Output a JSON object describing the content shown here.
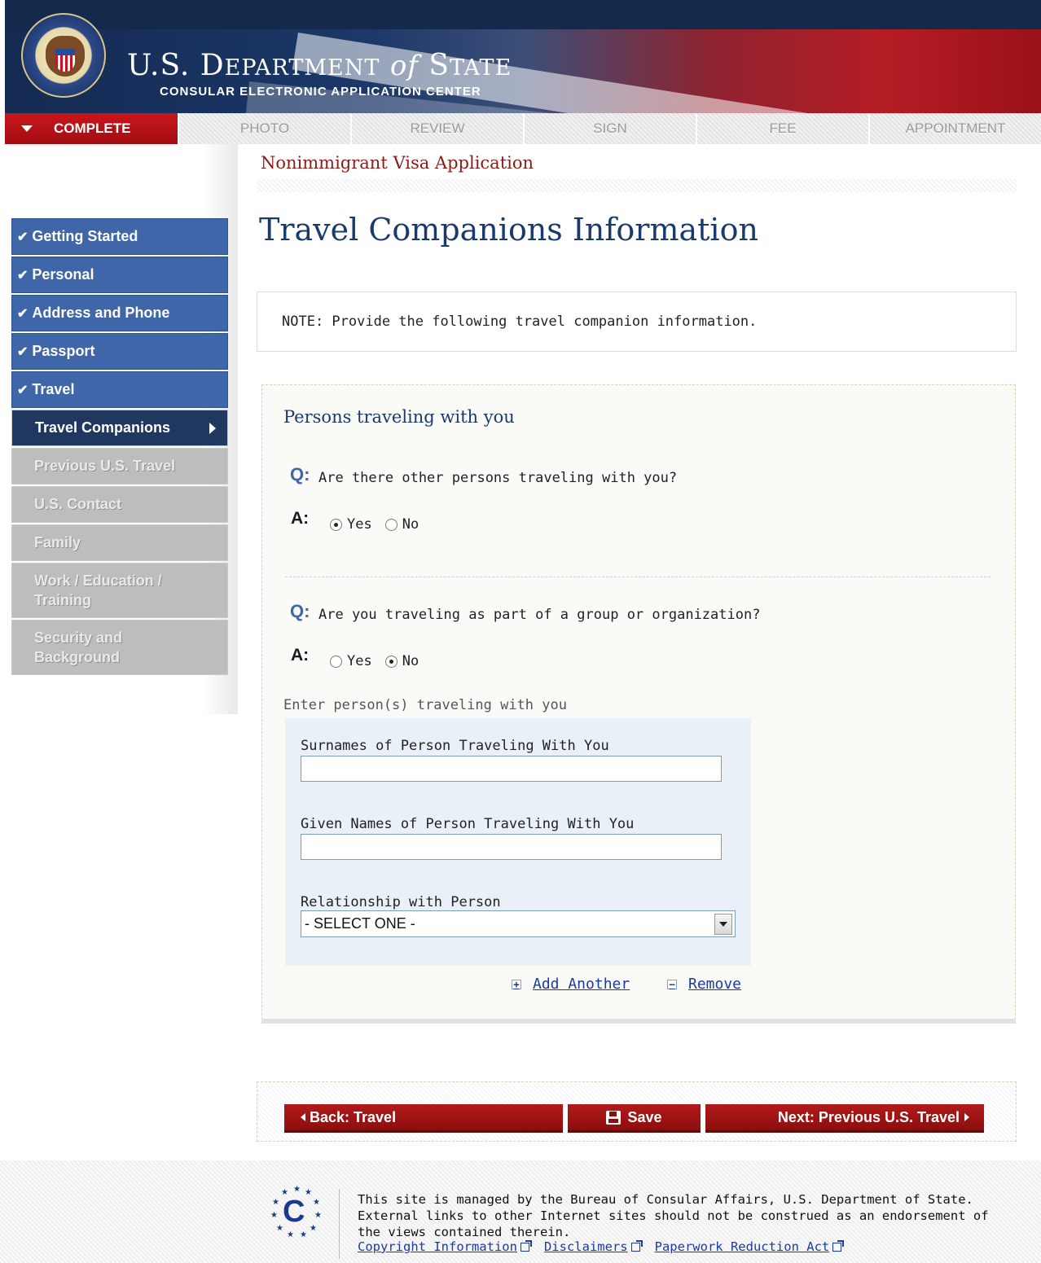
{
  "header": {
    "dept_main": "U.S. D",
    "dept_caps": "EPARTMENT",
    "dept_of": "of",
    "dept_state_s": "S",
    "dept_state_rest": "TATE",
    "subtitle": "CONSULAR ELECTRONIC APPLICATION CENTER"
  },
  "tabs": [
    {
      "label": "COMPLETE",
      "active": true
    },
    {
      "label": "PHOTO"
    },
    {
      "label": "REVIEW"
    },
    {
      "label": "SIGN"
    },
    {
      "label": "FEE"
    },
    {
      "label": "APPOINTMENT"
    }
  ],
  "sidebar": {
    "items": [
      {
        "label": "Getting Started",
        "state": "done"
      },
      {
        "label": "Personal",
        "state": "done"
      },
      {
        "label": "Address and Phone",
        "state": "done"
      },
      {
        "label": "Passport",
        "state": "done"
      },
      {
        "label": "Travel",
        "state": "done"
      },
      {
        "label": "Travel Companions",
        "state": "current"
      },
      {
        "label": "Previous U.S. Travel",
        "state": "todo"
      },
      {
        "label": "U.S. Contact",
        "state": "todo"
      },
      {
        "label": "Family",
        "state": "todo"
      },
      {
        "label": "Work / Education / Training",
        "state": "todo"
      },
      {
        "label": "Security and Background",
        "state": "todo"
      }
    ]
  },
  "main": {
    "app_title": "Nonimmigrant Visa Application",
    "page_heading": "Travel Companions Information",
    "note": "NOTE: Provide the following travel companion information.",
    "section_title": "Persons traveling with you",
    "q_marker": "Q:",
    "a_marker": "A:",
    "question1": "Are there other persons traveling with you?",
    "question2": "Are you traveling as part of a group or organization?",
    "yes_label": "Yes",
    "no_label": "No",
    "answer1": "Yes",
    "answer2": "No",
    "enter_label": "Enter person(s) traveling with you",
    "surname_label": "Surnames of Person Traveling With You",
    "surname_value": "",
    "given_label": "Given Names of Person Traveling With You",
    "given_value": "",
    "relationship_label": "Relationship with Person",
    "relationship_value": "- SELECT ONE -",
    "add_another": "Add Another",
    "remove": "Remove"
  },
  "buttons": {
    "back": "Back: Travel",
    "save": "Save",
    "next": "Next: Previous U.S. Travel"
  },
  "footer": {
    "text": "This site is managed by the Bureau of Consular Affairs, U.S. Department of State. External links to other Internet sites should not be construed as an endorsement of the views contained therein.",
    "links": [
      "Copyright Information",
      "Disclaimers",
      "Paperwork Reduction Act"
    ]
  }
}
